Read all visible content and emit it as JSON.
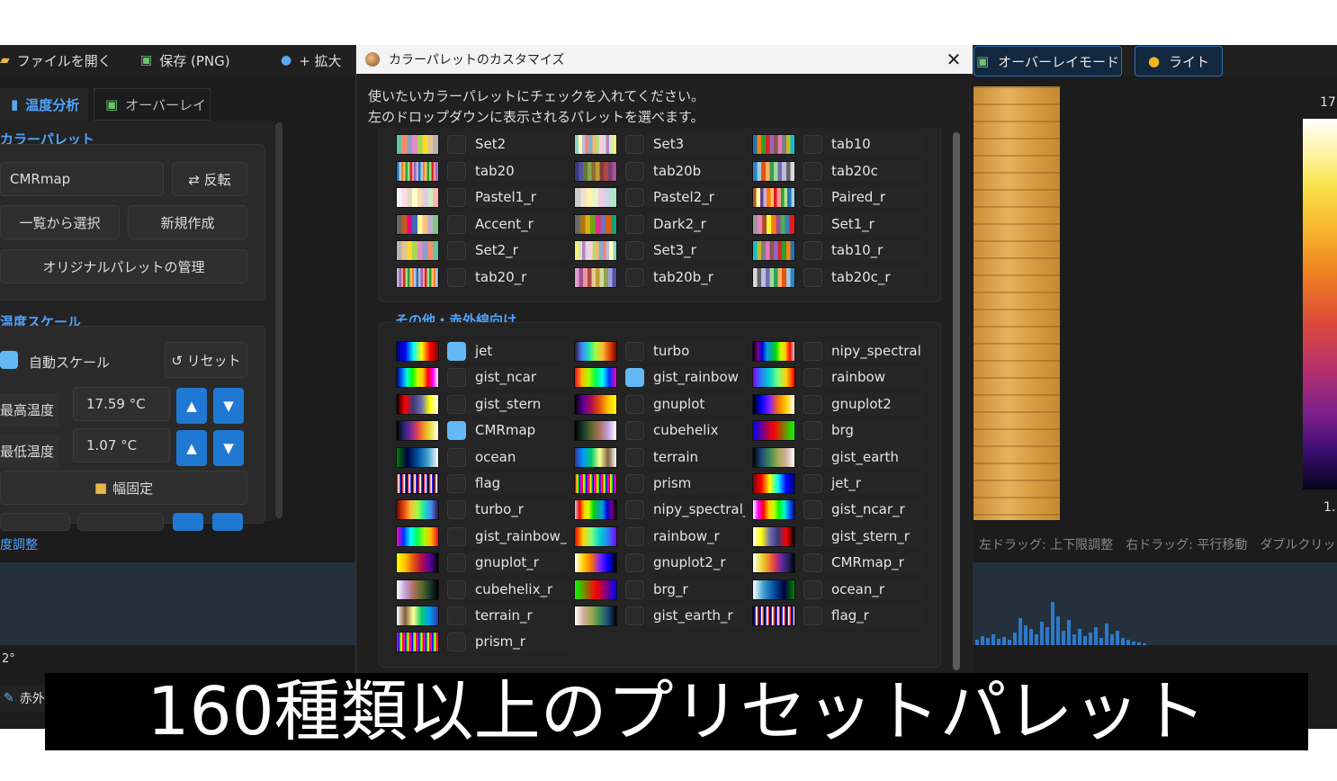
{
  "toolbar": {
    "open_file": "ファイルを開く",
    "save": "保存 (PNG)",
    "zoom_in": "+ 拡大",
    "overlay_mode": "オーバーレイモード",
    "light": "ライト"
  },
  "tabs": {
    "thermal": "温度分析",
    "overlay": "オーバーレイ"
  },
  "palette_section": {
    "title": "カラーパレット",
    "current": "CMRmap",
    "invert": "⇄ 反転",
    "select_from_list": "一覧から選択",
    "new": "新規作成",
    "manage": "オリジナルパレットの管理"
  },
  "scale_section": {
    "title": "温度スケール",
    "auto_scale": "自動スケール",
    "reset": "↺ リセット",
    "max_label": "最高温度",
    "max_value": "17.59 °C",
    "min_label": "最低温度",
    "min_value": "1.07 °C",
    "fixed_width": "幅固定"
  },
  "histogram": {
    "title": "度調整",
    "hint": "左ドラッグ: 上下限調整　右ドラッグ: 平行移動　ダブルクリック: リ",
    "axis_low": "2°",
    "bottom_tab": "赤外"
  },
  "colorbar": {
    "top": "17.",
    "bottom": "1."
  },
  "dialog": {
    "title": "カラーパレットのカスタマイズ",
    "close": "✕",
    "instruction_line1": "使いたいカラーパレットにチェックを入れてください。",
    "instruction_line2": "左のドロップダウンに表示されるパレットを選べます。",
    "group_other_title": "その他・赤外線向け",
    "qualitative": [
      {
        "name": "Set2",
        "checked": false
      },
      {
        "name": "Set3",
        "checked": false
      },
      {
        "name": "tab10",
        "checked": false
      },
      {
        "name": "tab20",
        "checked": false
      },
      {
        "name": "tab20b",
        "checked": false
      },
      {
        "name": "tab20c",
        "checked": false
      },
      {
        "name": "Pastel1_r",
        "checked": false
      },
      {
        "name": "Pastel2_r",
        "checked": false
      },
      {
        "name": "Paired_r",
        "checked": false
      },
      {
        "name": "Accent_r",
        "checked": false
      },
      {
        "name": "Dark2_r",
        "checked": false
      },
      {
        "name": "Set1_r",
        "checked": false
      },
      {
        "name": "Set2_r",
        "checked": false
      },
      {
        "name": "Set3_r",
        "checked": false
      },
      {
        "name": "tab10_r",
        "checked": false
      },
      {
        "name": "tab20_r",
        "checked": false
      },
      {
        "name": "tab20b_r",
        "checked": false
      },
      {
        "name": "tab20c_r",
        "checked": false
      }
    ],
    "other": [
      {
        "name": "jet",
        "checked": true
      },
      {
        "name": "turbo",
        "checked": false
      },
      {
        "name": "nipy_spectral",
        "checked": false
      },
      {
        "name": "gist_ncar",
        "checked": false
      },
      {
        "name": "gist_rainbow",
        "checked": true
      },
      {
        "name": "rainbow",
        "checked": false
      },
      {
        "name": "gist_stern",
        "checked": false
      },
      {
        "name": "gnuplot",
        "checked": false
      },
      {
        "name": "gnuplot2",
        "checked": false
      },
      {
        "name": "CMRmap",
        "checked": true
      },
      {
        "name": "cubehelix",
        "checked": false
      },
      {
        "name": "brg",
        "checked": false
      },
      {
        "name": "ocean",
        "checked": false
      },
      {
        "name": "terrain",
        "checked": false
      },
      {
        "name": "gist_earth",
        "checked": false
      },
      {
        "name": "flag",
        "checked": false
      },
      {
        "name": "prism",
        "checked": false
      },
      {
        "name": "jet_r",
        "checked": false
      },
      {
        "name": "turbo_r",
        "checked": false
      },
      {
        "name": "nipy_spectral_r",
        "checked": false
      },
      {
        "name": "gist_ncar_r",
        "checked": false
      },
      {
        "name": "gist_rainbow_r",
        "checked": false
      },
      {
        "name": "rainbow_r",
        "checked": false
      },
      {
        "name": "gist_stern_r",
        "checked": false
      },
      {
        "name": "gnuplot_r",
        "checked": false
      },
      {
        "name": "gnuplot2_r",
        "checked": false
      },
      {
        "name": "CMRmap_r",
        "checked": false
      },
      {
        "name": "cubehelix_r",
        "checked": false
      },
      {
        "name": "brg_r",
        "checked": false
      },
      {
        "name": "ocean_r",
        "checked": false
      },
      {
        "name": "terrain_r",
        "checked": false
      },
      {
        "name": "gist_earth_r",
        "checked": false
      },
      {
        "name": "flag_r",
        "checked": false
      },
      {
        "name": "prism_r",
        "checked": false
      }
    ]
  },
  "caption": "160種類以上のプリセットパレット",
  "colors": {
    "accent": "#4ea3ff",
    "check": "#63b8f5",
    "spin": "#1f78d1"
  }
}
